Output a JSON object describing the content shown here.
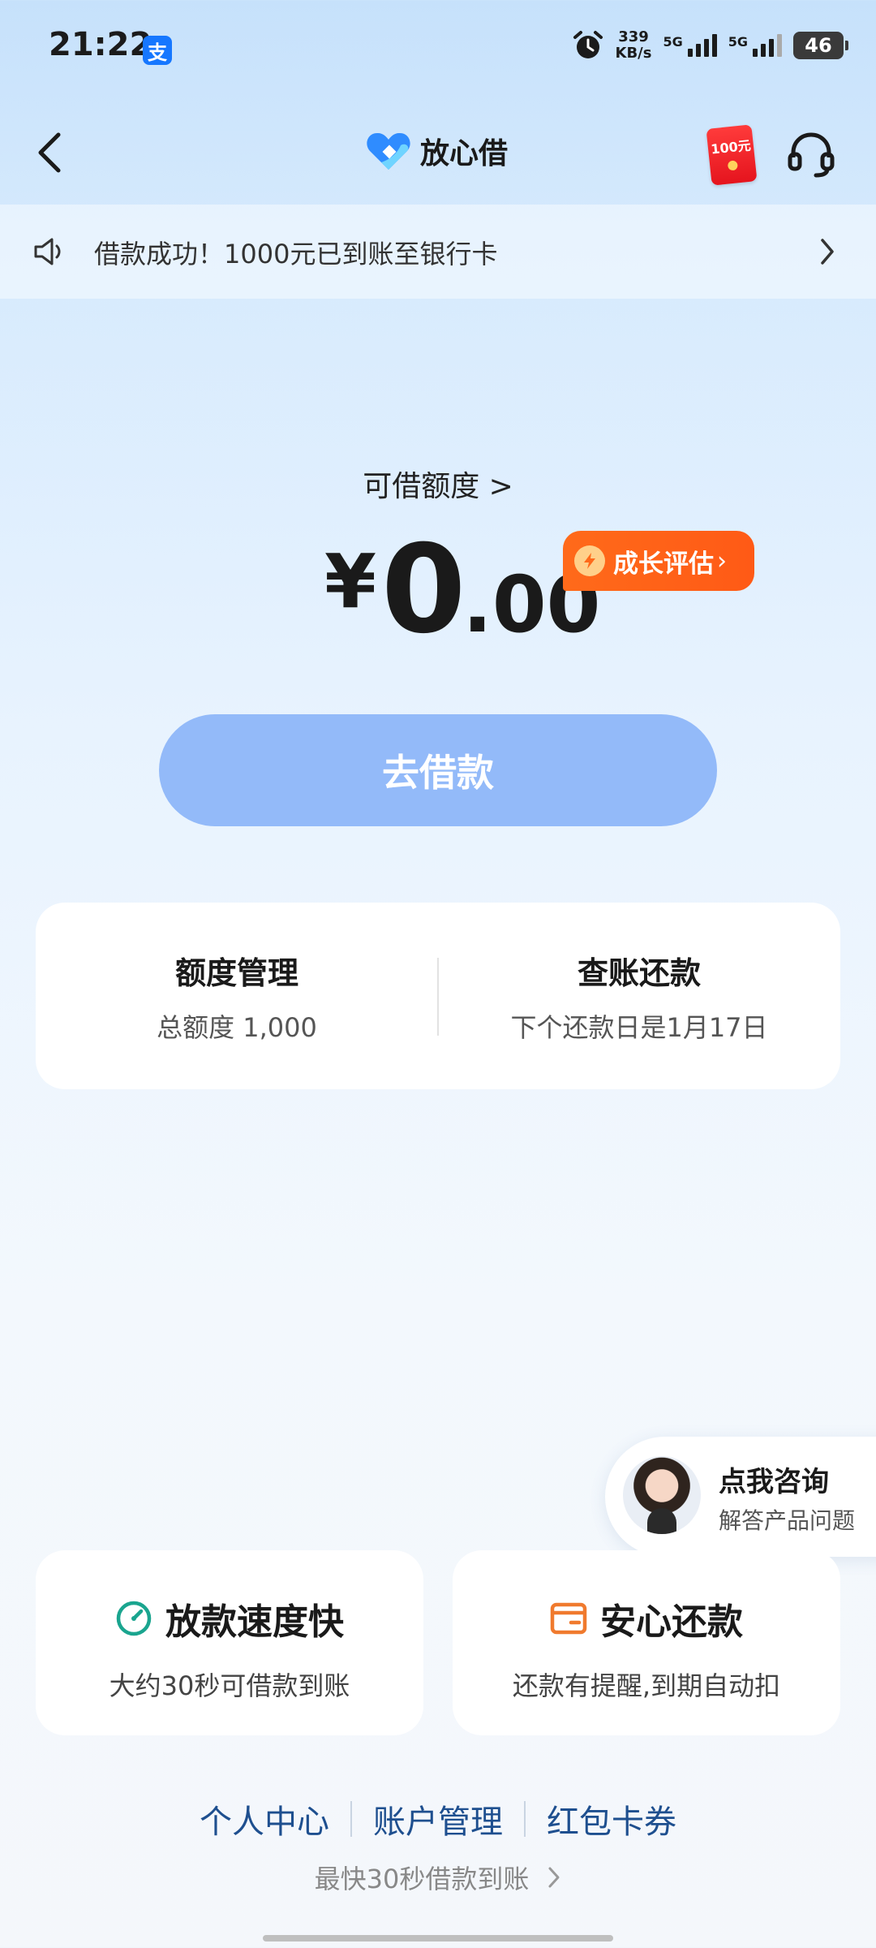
{
  "status_bar": {
    "time": "21:22",
    "app_badge": "支",
    "net_speed_value": "339",
    "net_speed_unit": "KB/s",
    "sim1_label": "5G",
    "sim2_label": "5G",
    "battery": "46"
  },
  "nav": {
    "brand": "放心借",
    "redpacket_label": "100元"
  },
  "notice": {
    "text": "借款成功！1000元已到账至银行卡"
  },
  "credit": {
    "label": "可借额度 >",
    "currency": "¥",
    "amount_int": "0",
    "amount_dec": ".00",
    "growth_label": "成长评估"
  },
  "borrow_button": "去借款",
  "cards": {
    "limit_title": "额度管理",
    "limit_sub": "总额度 1,000",
    "bill_title": "查账还款",
    "bill_sub": "下个还款日是1月17日"
  },
  "consult": {
    "title": "点我咨询",
    "subtitle": "解答产品问题"
  },
  "features": [
    {
      "title": "放款速度快",
      "subtitle": "大约30秒可借款到账",
      "color": "#1aa58f"
    },
    {
      "title": "安心还款",
      "subtitle": "还款有提醒,到期自动扣",
      "color": "#f07a2e"
    }
  ],
  "links": [
    "个人中心",
    "账户管理",
    "红包卡券"
  ],
  "tagline": "最快30秒借款到账",
  "colors": {
    "accent": "#1677ff",
    "button": "#93baf9",
    "growth": "#ff6a1a",
    "link": "#1e4f8f"
  }
}
